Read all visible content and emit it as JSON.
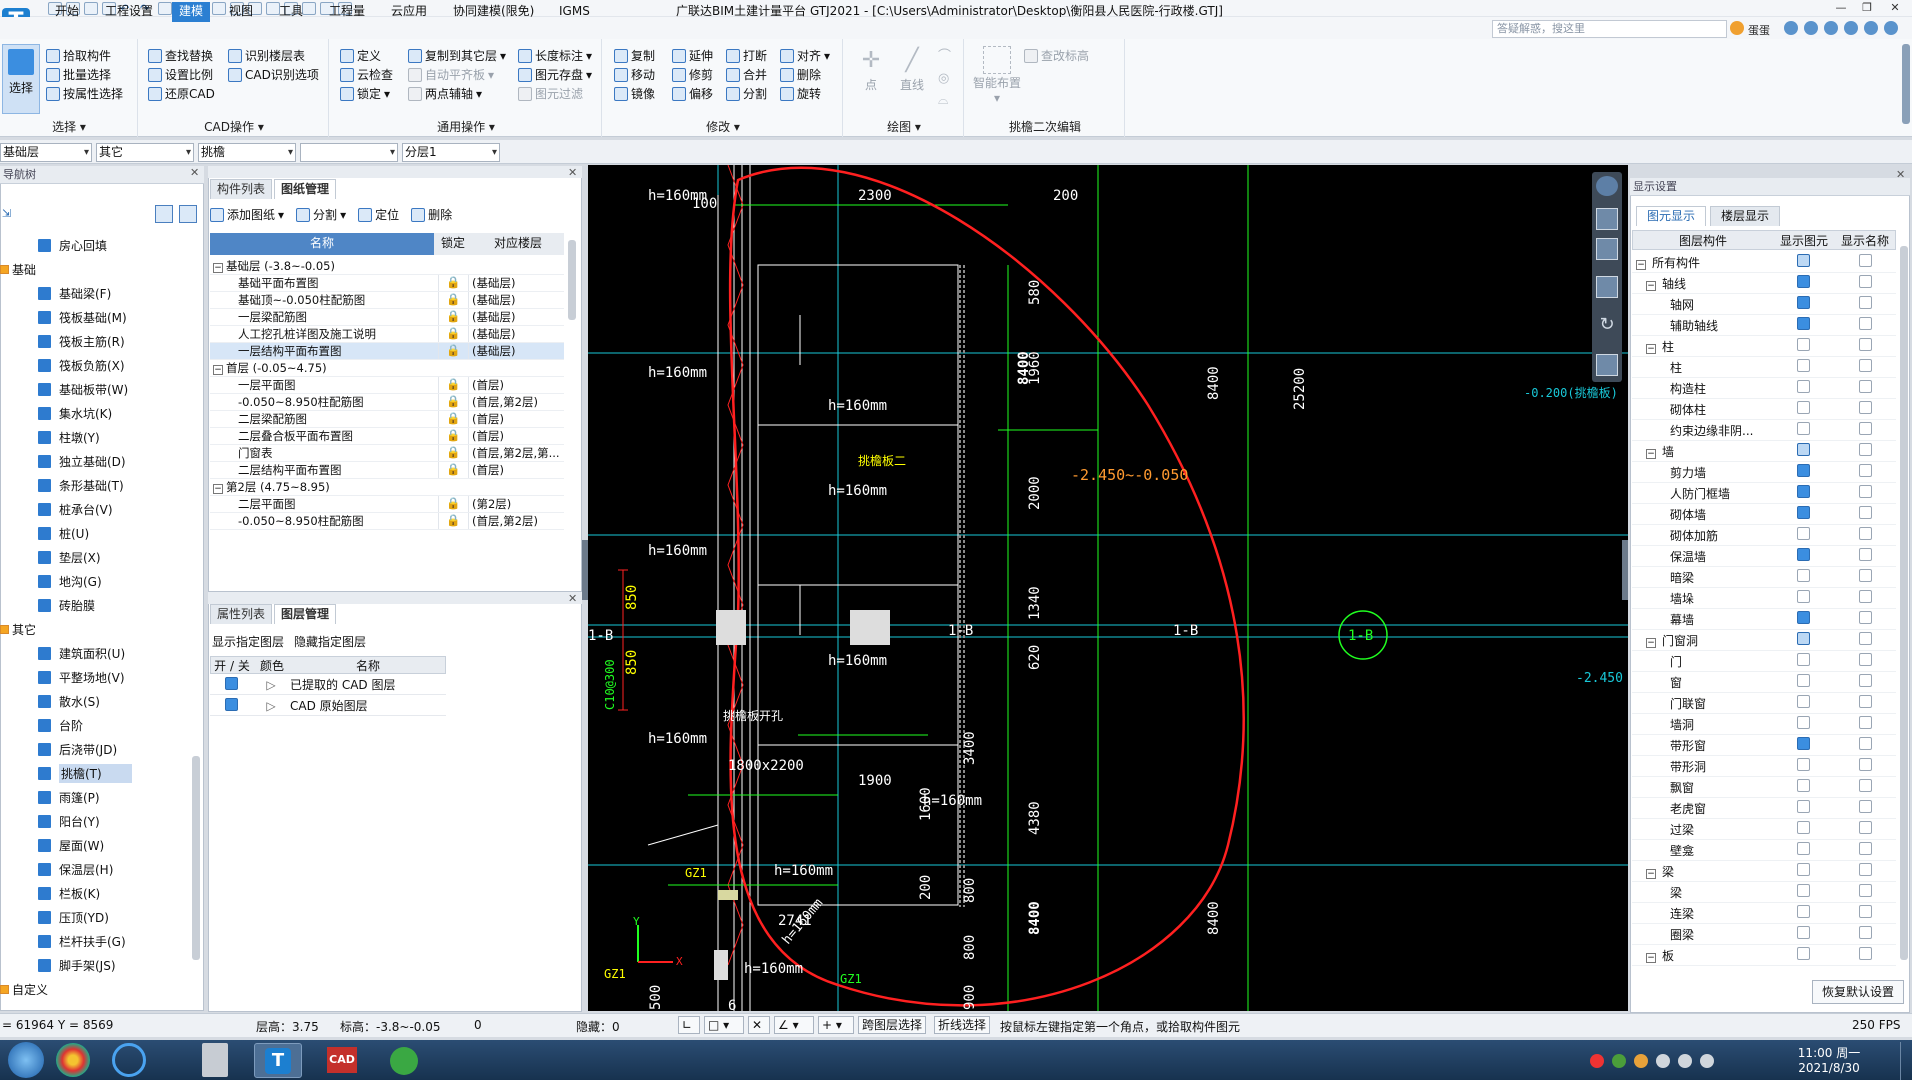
{
  "window": {
    "title": "广联达BIM土建计量平台 GTJ2021 - [C:\\Users\\Administrator\\Desktop\\衡阳县人民医院-行政楼.GTJ]",
    "controls": {
      "min": "—",
      "restore": "❐",
      "close": "✕"
    }
  },
  "menu": {
    "tabs": [
      "开始",
      "工程设置",
      "建模",
      "视图",
      "工具",
      "工程量",
      "云应用",
      "协同建模(限免)",
      "IGMS"
    ],
    "active": "建模",
    "search_placeholder": "答疑解惑，搜这里",
    "user": "蛋蛋"
  },
  "ribbon": {
    "select": {
      "big": "选择",
      "btns": [
        "拾取构件",
        "批量选择",
        "按属性选择"
      ],
      "group": "选择"
    },
    "cad": {
      "btns": [
        "查找替换",
        "设置比例",
        "还原CAD",
        "识别楼层表",
        "CAD识别选项"
      ],
      "group": "CAD操作"
    },
    "general": {
      "btns": [
        "定义",
        "云检查",
        "锁定",
        "复制到其它层",
        "自动平齐板",
        "两点辅轴",
        "长度标注",
        "图元存盘",
        "图元过滤"
      ],
      "group": "通用操作"
    },
    "modify": {
      "btns": [
        "复制",
        "移动",
        "镜像",
        "延伸",
        "修剪",
        "偏移",
        "打断",
        "合并",
        "分割",
        "对齐",
        "删除",
        "旋转"
      ],
      "group": "修改"
    },
    "draw": {
      "btns": [
        "点",
        "直线"
      ],
      "group": "绘图"
    },
    "edit": {
      "btns": [
        "智能布置",
        "查改标高"
      ],
      "group": "挑檐二次编辑"
    }
  },
  "combos": [
    "基础层",
    "其它",
    "挑檐",
    "",
    "分层1"
  ],
  "nav": {
    "title": "导航树",
    "items_top": [
      {
        "label": "房心回填",
        "sel": false
      }
    ],
    "group1": "基础",
    "items1": [
      "基础梁(F)",
      "筏板基础(M)",
      "筏板主筋(R)",
      "筏板负筋(X)",
      "基础板带(W)",
      "集水坑(K)",
      "柱墩(Y)",
      "独立基础(D)",
      "条形基础(T)",
      "桩承台(V)",
      "桩(U)",
      "垫层(X)",
      "地沟(G)",
      "砖胎膜"
    ],
    "group2": "其它",
    "items2": [
      "建筑面积(U)",
      "平整场地(V)",
      "散水(S)",
      "台阶",
      "后浇带(JD)",
      "挑檐(T)",
      "雨篷(P)",
      "阳台(Y)",
      "屋面(W)",
      "保温层(H)",
      "栏板(K)",
      "压顶(YD)",
      "栏杆扶手(G)",
      "脚手架(JS)"
    ],
    "selected": "挑檐(T)",
    "group3": "自定义"
  },
  "drawings": {
    "tabs": [
      "构件列表",
      "图纸管理"
    ],
    "active_tab": "图纸管理",
    "toolbar": [
      "添加图纸",
      "分割",
      "定位",
      "删除"
    ],
    "headers": [
      "名称",
      "锁定",
      "对应楼层"
    ],
    "rows": [
      {
        "name": "基础层 (-3.8~-0.05)",
        "floor": "",
        "group": true
      },
      {
        "name": "基础平面布置图",
        "floor": "(基础层)"
      },
      {
        "name": "基础顶~-0.050柱配筋图",
        "floor": "(基础层)"
      },
      {
        "name": "一层梁配筋图",
        "floor": "(基础层)"
      },
      {
        "name": "人工挖孔桩详图及施工说明",
        "floor": "(基础层)"
      },
      {
        "name": "一层结构平面布置图",
        "floor": "(基础层)",
        "sel": true
      },
      {
        "name": "首层 (-0.05~4.75)",
        "floor": "",
        "group": true
      },
      {
        "name": "一层平面图",
        "floor": "(首层)"
      },
      {
        "name": "-0.050~8.950柱配筋图",
        "floor": "(首层,第2层)"
      },
      {
        "name": "二层梁配筋图",
        "floor": "(首层)"
      },
      {
        "name": "二层叠合板平面布置图",
        "floor": "(首层)"
      },
      {
        "name": "门窗表",
        "floor": "(首层,第2层,第..."
      },
      {
        "name": "二层结构平面布置图",
        "floor": "(首层)"
      },
      {
        "name": "第2层 (4.75~8.95)",
        "floor": "",
        "group": true
      },
      {
        "name": "二层平面图",
        "floor": "(第2层)"
      },
      {
        "name": "-0.050~8.950柱配筋图",
        "floor": "(首层,第2层)"
      }
    ]
  },
  "layers": {
    "tabs": [
      "属性列表",
      "图层管理"
    ],
    "active_tab": "图层管理",
    "actions": [
      "显示指定图层",
      "隐藏指定图层"
    ],
    "headers": [
      "开 / 关",
      "颜色",
      "名称"
    ],
    "rows": [
      "已提取的 CAD 图层",
      "CAD 原始图层"
    ]
  },
  "display": {
    "title": "显示设置",
    "tabs": [
      "图元显示",
      "楼层显示"
    ],
    "headers": [
      "图层构件",
      "显示图元",
      "显示名称"
    ],
    "rows": [
      {
        "label": "所有构件",
        "lvl": 0,
        "show": "part",
        "name": false
      },
      {
        "label": "轴线",
        "lvl": 1,
        "show": "on",
        "name": false
      },
      {
        "label": "轴网",
        "lvl": 2,
        "show": "on",
        "name": false
      },
      {
        "label": "辅助轴线",
        "lvl": 2,
        "show": "on",
        "name": false
      },
      {
        "label": "柱",
        "lvl": 1,
        "show": "off",
        "name": false
      },
      {
        "label": "柱",
        "lvl": 2,
        "show": "off",
        "name": false
      },
      {
        "label": "构造柱",
        "lvl": 2,
        "show": "off",
        "name": false
      },
      {
        "label": "砌体柱",
        "lvl": 2,
        "show": "off",
        "name": false
      },
      {
        "label": "约束边缘非阴...",
        "lvl": 2,
        "show": "off",
        "name": false
      },
      {
        "label": "墙",
        "lvl": 1,
        "show": "part",
        "name": false
      },
      {
        "label": "剪力墙",
        "lvl": 2,
        "show": "on",
        "name": false
      },
      {
        "label": "人防门框墙",
        "lvl": 2,
        "show": "on",
        "name": false
      },
      {
        "label": "砌体墙",
        "lvl": 2,
        "show": "on",
        "name": false
      },
      {
        "label": "砌体加筋",
        "lvl": 2,
        "show": "off",
        "name": false
      },
      {
        "label": "保温墙",
        "lvl": 2,
        "show": "on",
        "name": false
      },
      {
        "label": "暗梁",
        "lvl": 2,
        "show": "off",
        "name": false
      },
      {
        "label": "墙垛",
        "lvl": 2,
        "show": "off",
        "name": false
      },
      {
        "label": "幕墙",
        "lvl": 2,
        "show": "on",
        "name": false
      },
      {
        "label": "门窗洞",
        "lvl": 1,
        "show": "part",
        "name": false
      },
      {
        "label": "门",
        "lvl": 2,
        "show": "off",
        "name": false
      },
      {
        "label": "窗",
        "lvl": 2,
        "show": "off",
        "name": false
      },
      {
        "label": "门联窗",
        "lvl": 2,
        "show": "off",
        "name": false
      },
      {
        "label": "墙洞",
        "lvl": 2,
        "show": "off",
        "name": false
      },
      {
        "label": "带形窗",
        "lvl": 2,
        "show": "on",
        "name": false
      },
      {
        "label": "带形洞",
        "lvl": 2,
        "show": "off",
        "name": false
      },
      {
        "label": "飘窗",
        "lvl": 2,
        "show": "off",
        "name": false
      },
      {
        "label": "老虎窗",
        "lvl": 2,
        "show": "off",
        "name": false
      },
      {
        "label": "过梁",
        "lvl": 2,
        "show": "off",
        "name": false
      },
      {
        "label": "壁龛",
        "lvl": 2,
        "show": "off",
        "name": false
      },
      {
        "label": "梁",
        "lvl": 1,
        "show": "off",
        "name": false
      },
      {
        "label": "梁",
        "lvl": 2,
        "show": "off",
        "name": false
      },
      {
        "label": "连梁",
        "lvl": 2,
        "show": "off",
        "name": false
      },
      {
        "label": "圈梁",
        "lvl": 2,
        "show": "off",
        "name": false
      },
      {
        "label": "板",
        "lvl": 1,
        "show": "off",
        "name": false
      }
    ],
    "reset": "恢复默认设置"
  },
  "cad": {
    "texts": {
      "h1": "h=160mm",
      "d100": "100",
      "d2300": "2300",
      "d200": "200",
      "d580": "580",
      "d1960": "1960",
      "d8400a": "8400",
      "d8400b": "8400",
      "d25200": "25200",
      "el1": "-0.200(挑檐板)",
      "tag1": "挑檐板二",
      "el2": "-2.450~-0.050",
      "d2000": "2000",
      "d1340": "1340",
      "d620": "620",
      "ax1": "1-B",
      "ax2": "1-B",
      "ax3": "1-B",
      "red850a": "850",
      "red850b": "850",
      "c10": "C10@300",
      "el3": "-2.450",
      "tag2": "挑檐板开孔",
      "d1800": "1800x2200",
      "d1900": "1900",
      "d3400": "3400",
      "d1600": "1600",
      "d4380": "4380",
      "d800a": "800",
      "d800b": "800",
      "d8400c": "8400",
      "d8400d": "8400",
      "d2741": "2741",
      "gz1a": "GZ1",
      "gz1b": "GZ1",
      "gz1c": "GZ1",
      "d900": "900",
      "d500": "500",
      "d200b": "200",
      "d6": "6",
      "y": "Y",
      "x": "X"
    }
  },
  "status": {
    "coords": "= 61964 Y = 8569",
    "floor_h": "层高：3.75",
    "elev": "标高：-3.8~-0.05",
    "zero": "0",
    "hidden": "隐藏：0",
    "btn1": "跨图层选择",
    "btn2": "折线选择",
    "hint": "按鼠标左键指定第一个角点，或拾取构件图元",
    "fps": "250 FPS"
  },
  "taskbar": {
    "time": "11:00 周一",
    "date": "2021/8/30",
    "apps": [
      "start",
      "chrome",
      "search",
      "calculator",
      "gtj",
      "cad",
      "360"
    ]
  }
}
